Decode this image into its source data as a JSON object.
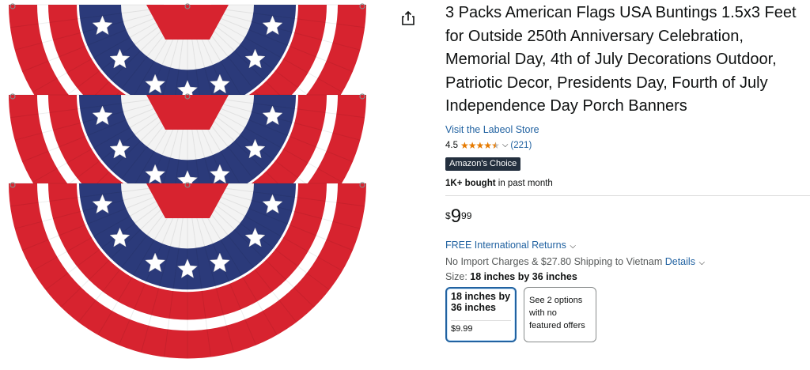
{
  "product": {
    "title": "3 Packs American Flags USA Buntings 1.5x3 Feet for Outside 250th Anniversary Celebration, Memorial Day, 4th of July Decorations Outdoor, Patriotic Decor, Presidents Day, Fourth of July Independence Day Porch Banners",
    "store_link": "Visit the Labeol Store",
    "rating_value": "4.5",
    "rating_stars": 4.5,
    "rating_count": "(221)",
    "badge": "Amazon's Choice",
    "bought_strong": "1K+ bought",
    "bought_rest": " in past month"
  },
  "price": {
    "symbol": "$",
    "whole": "9",
    "fraction": "99"
  },
  "delivery": {
    "returns": "FREE International Returns",
    "shipping_text": "No Import Charges & $27.80 Shipping to Vietnam",
    "details_link": "Details"
  },
  "size": {
    "label": "Size:",
    "selected": "18 inches by 36 inches",
    "options": [
      {
        "name": "18 inches by 36 inches",
        "price": "$9.99"
      },
      {
        "text": "See 2 options with no featured offers"
      }
    ]
  },
  "icons": {
    "share": "share-icon",
    "chevron": "chevron-down-icon",
    "star": "star-icon"
  },
  "colors": {
    "link": "#2162a1",
    "star": "#e67a00",
    "badge_bg": "#232f3e",
    "flag_red": "#d7232f",
    "flag_blue": "#2b3a7a"
  }
}
